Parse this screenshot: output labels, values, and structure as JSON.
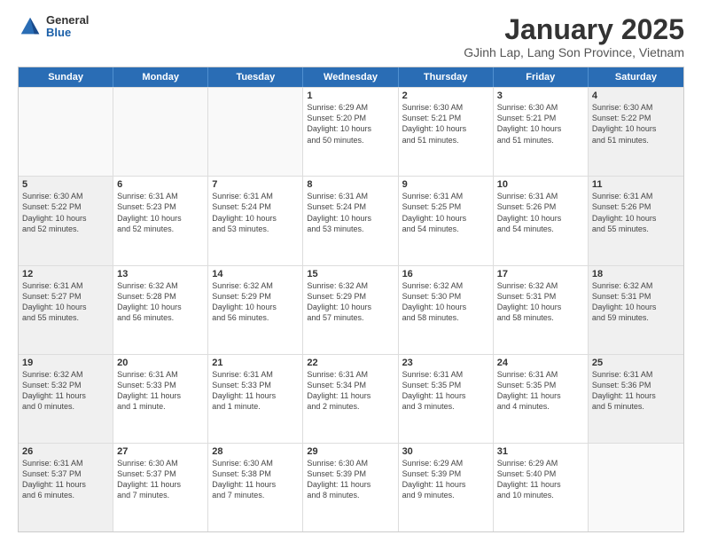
{
  "logo": {
    "general": "General",
    "blue": "Blue"
  },
  "title": "January 2025",
  "subtitle": "GJinh Lap, Lang Son Province, Vietnam",
  "days": [
    "Sunday",
    "Monday",
    "Tuesday",
    "Wednesday",
    "Thursday",
    "Friday",
    "Saturday"
  ],
  "weeks": [
    [
      {
        "day": "",
        "info": ""
      },
      {
        "day": "",
        "info": ""
      },
      {
        "day": "",
        "info": ""
      },
      {
        "day": "1",
        "info": "Sunrise: 6:29 AM\nSunset: 5:20 PM\nDaylight: 10 hours\nand 50 minutes."
      },
      {
        "day": "2",
        "info": "Sunrise: 6:30 AM\nSunset: 5:21 PM\nDaylight: 10 hours\nand 51 minutes."
      },
      {
        "day": "3",
        "info": "Sunrise: 6:30 AM\nSunset: 5:21 PM\nDaylight: 10 hours\nand 51 minutes."
      },
      {
        "day": "4",
        "info": "Sunrise: 6:30 AM\nSunset: 5:22 PM\nDaylight: 10 hours\nand 51 minutes."
      }
    ],
    [
      {
        "day": "5",
        "info": "Sunrise: 6:30 AM\nSunset: 5:22 PM\nDaylight: 10 hours\nand 52 minutes."
      },
      {
        "day": "6",
        "info": "Sunrise: 6:31 AM\nSunset: 5:23 PM\nDaylight: 10 hours\nand 52 minutes."
      },
      {
        "day": "7",
        "info": "Sunrise: 6:31 AM\nSunset: 5:24 PM\nDaylight: 10 hours\nand 53 minutes."
      },
      {
        "day": "8",
        "info": "Sunrise: 6:31 AM\nSunset: 5:24 PM\nDaylight: 10 hours\nand 53 minutes."
      },
      {
        "day": "9",
        "info": "Sunrise: 6:31 AM\nSunset: 5:25 PM\nDaylight: 10 hours\nand 54 minutes."
      },
      {
        "day": "10",
        "info": "Sunrise: 6:31 AM\nSunset: 5:26 PM\nDaylight: 10 hours\nand 54 minutes."
      },
      {
        "day": "11",
        "info": "Sunrise: 6:31 AM\nSunset: 5:26 PM\nDaylight: 10 hours\nand 55 minutes."
      }
    ],
    [
      {
        "day": "12",
        "info": "Sunrise: 6:31 AM\nSunset: 5:27 PM\nDaylight: 10 hours\nand 55 minutes."
      },
      {
        "day": "13",
        "info": "Sunrise: 6:32 AM\nSunset: 5:28 PM\nDaylight: 10 hours\nand 56 minutes."
      },
      {
        "day": "14",
        "info": "Sunrise: 6:32 AM\nSunset: 5:29 PM\nDaylight: 10 hours\nand 56 minutes."
      },
      {
        "day": "15",
        "info": "Sunrise: 6:32 AM\nSunset: 5:29 PM\nDaylight: 10 hours\nand 57 minutes."
      },
      {
        "day": "16",
        "info": "Sunrise: 6:32 AM\nSunset: 5:30 PM\nDaylight: 10 hours\nand 58 minutes."
      },
      {
        "day": "17",
        "info": "Sunrise: 6:32 AM\nSunset: 5:31 PM\nDaylight: 10 hours\nand 58 minutes."
      },
      {
        "day": "18",
        "info": "Sunrise: 6:32 AM\nSunset: 5:31 PM\nDaylight: 10 hours\nand 59 minutes."
      }
    ],
    [
      {
        "day": "19",
        "info": "Sunrise: 6:32 AM\nSunset: 5:32 PM\nDaylight: 11 hours\nand 0 minutes."
      },
      {
        "day": "20",
        "info": "Sunrise: 6:31 AM\nSunset: 5:33 PM\nDaylight: 11 hours\nand 1 minute."
      },
      {
        "day": "21",
        "info": "Sunrise: 6:31 AM\nSunset: 5:33 PM\nDaylight: 11 hours\nand 1 minute."
      },
      {
        "day": "22",
        "info": "Sunrise: 6:31 AM\nSunset: 5:34 PM\nDaylight: 11 hours\nand 2 minutes."
      },
      {
        "day": "23",
        "info": "Sunrise: 6:31 AM\nSunset: 5:35 PM\nDaylight: 11 hours\nand 3 minutes."
      },
      {
        "day": "24",
        "info": "Sunrise: 6:31 AM\nSunset: 5:35 PM\nDaylight: 11 hours\nand 4 minutes."
      },
      {
        "day": "25",
        "info": "Sunrise: 6:31 AM\nSunset: 5:36 PM\nDaylight: 11 hours\nand 5 minutes."
      }
    ],
    [
      {
        "day": "26",
        "info": "Sunrise: 6:31 AM\nSunset: 5:37 PM\nDaylight: 11 hours\nand 6 minutes."
      },
      {
        "day": "27",
        "info": "Sunrise: 6:30 AM\nSunset: 5:37 PM\nDaylight: 11 hours\nand 7 minutes."
      },
      {
        "day": "28",
        "info": "Sunrise: 6:30 AM\nSunset: 5:38 PM\nDaylight: 11 hours\nand 7 minutes."
      },
      {
        "day": "29",
        "info": "Sunrise: 6:30 AM\nSunset: 5:39 PM\nDaylight: 11 hours\nand 8 minutes."
      },
      {
        "day": "30",
        "info": "Sunrise: 6:29 AM\nSunset: 5:39 PM\nDaylight: 11 hours\nand 9 minutes."
      },
      {
        "day": "31",
        "info": "Sunrise: 6:29 AM\nSunset: 5:40 PM\nDaylight: 11 hours\nand 10 minutes."
      },
      {
        "day": "",
        "info": ""
      }
    ]
  ]
}
